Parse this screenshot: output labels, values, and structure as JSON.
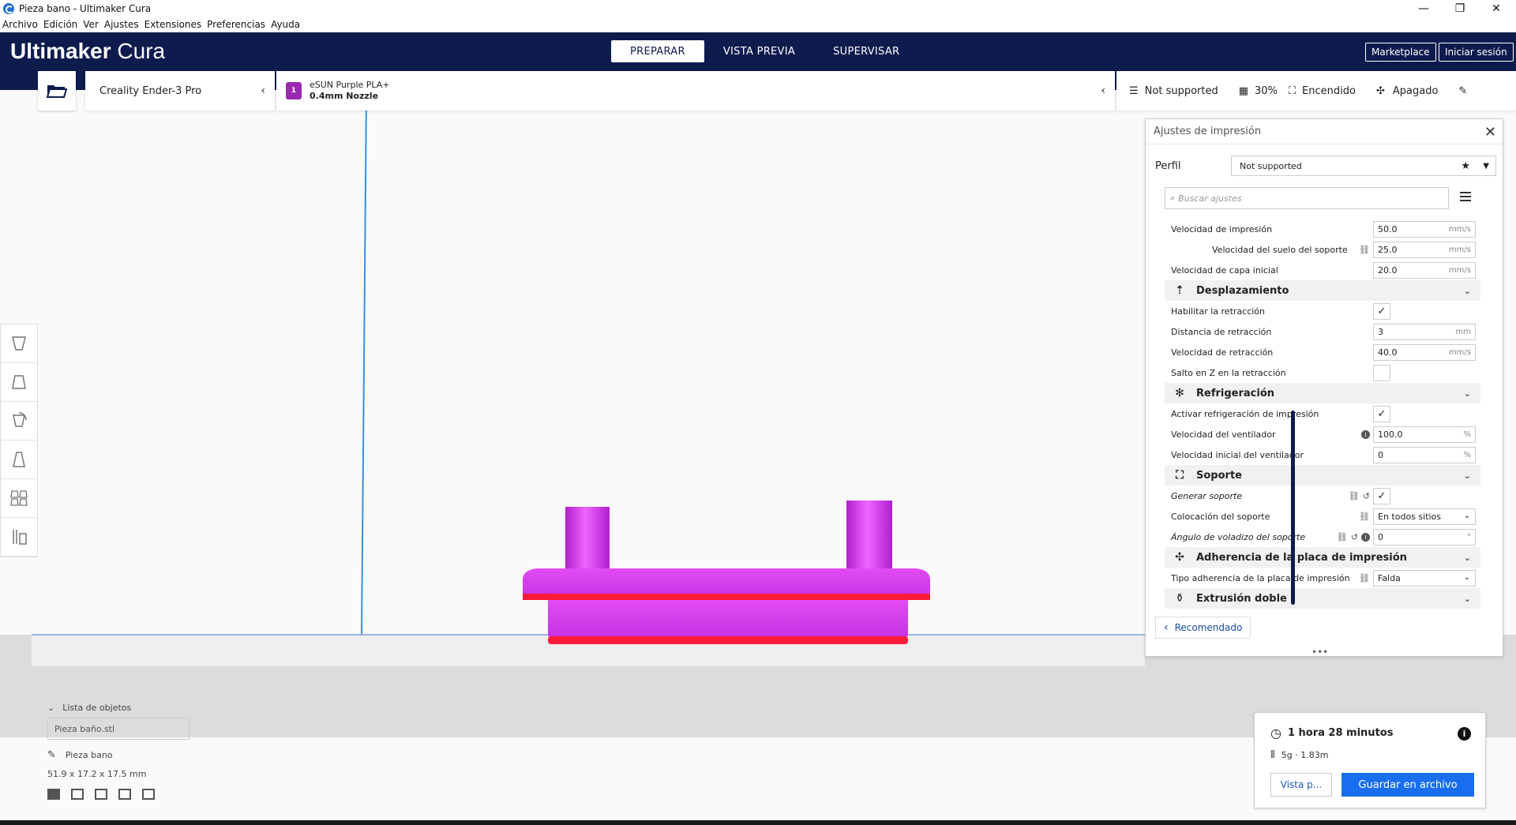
{
  "window": {
    "title": "Pieza bano - Ultimaker Cura"
  },
  "menu": [
    "Archivo",
    "Edición",
    "Ver",
    "Ajustes",
    "Extensiones",
    "Preferencias",
    "Ayuda"
  ],
  "header": {
    "logo_bold": "Ultimaker",
    "logo_light": "Cura",
    "stages": [
      "PREPARAR",
      "VISTA PREVIA",
      "SUPERVISAR"
    ],
    "marketplace": "Marketplace",
    "signin": "Iniciar sesión"
  },
  "printer": {
    "name": "Creality Ender-3 Pro"
  },
  "material": {
    "name": "eSUN Purple PLA+",
    "nozzle": "0.4mm Nozzle",
    "extruder": "1",
    "color": "#9c27b0"
  },
  "quick_settings": {
    "profile": "Not supported",
    "infill": "30%",
    "support": "Encendido",
    "adhesion": "Apagado"
  },
  "panel": {
    "title": "Ajustes de impresión",
    "profile_label": "Perfil",
    "profile_value": "Not supported",
    "search_placeholder": "Buscar ajustes",
    "rows": [
      {
        "type": "field",
        "label": "Velocidad de impresión",
        "value": "50.0",
        "unit": "mm/s"
      },
      {
        "type": "field",
        "label": "Velocidad del suelo del soporte",
        "value": "25.0",
        "unit": "mm/s",
        "indent": true,
        "link": true
      },
      {
        "type": "field",
        "label": "Velocidad de capa inicial",
        "value": "20.0",
        "unit": "mm/s"
      },
      {
        "type": "cat",
        "label": "Desplazamiento"
      },
      {
        "type": "check",
        "label": "Habilitar la retracción",
        "checked": true
      },
      {
        "type": "field",
        "label": "Distancia de retracción",
        "value": "3",
        "unit": "mm"
      },
      {
        "type": "field",
        "label": "Velocidad de retracción",
        "value": "40.0",
        "unit": "mm/s"
      },
      {
        "type": "check",
        "label": "Salto en Z en la retracción",
        "checked": false
      },
      {
        "type": "cat",
        "label": "Refrigeración"
      },
      {
        "type": "check",
        "label": "Activar refrigeración de impresión",
        "checked": true
      },
      {
        "type": "field",
        "label": "Velocidad del ventilador",
        "value": "100.0",
        "unit": "%",
        "info": true
      },
      {
        "type": "field",
        "label": "Velocidad inicial del ventilador",
        "value": "0",
        "unit": "%"
      },
      {
        "type": "cat",
        "label": "Soporte"
      },
      {
        "type": "check",
        "label": "Generar soporte",
        "checked": true,
        "italic": true,
        "link": true,
        "reset": true
      },
      {
        "type": "select",
        "label": "Colocación del soporte",
        "value": "En todos sitios",
        "link": true
      },
      {
        "type": "field",
        "label": "Ángulo de voladizo del soporte",
        "value": "0",
        "unit": "°",
        "italic": true,
        "link": true,
        "reset": true,
        "info": true
      },
      {
        "type": "cat",
        "label": "Adherencia de la placa de impresión"
      },
      {
        "type": "select",
        "label": "Tipo adherencia de la placa de impresión",
        "value": "Falda",
        "link": true
      },
      {
        "type": "cat",
        "label": "Extrusión doble"
      }
    ],
    "recommended": "Recomendado"
  },
  "objects": {
    "title": "Lista de objetos",
    "file": "Pieza baño.stl",
    "name": "Pieza bano",
    "dims": "51.9 x 17.2 x 17.5 mm"
  },
  "summary": {
    "time": "1 hora 28 minutos",
    "material": "5g · 1.83m",
    "preview": "Vista p...",
    "save": "Guardar en archivo"
  },
  "colors": {
    "header": "#0e1b4d",
    "accent": "#196ef0",
    "model": "#d833f0",
    "model_bottom": "#ff1a3a"
  }
}
